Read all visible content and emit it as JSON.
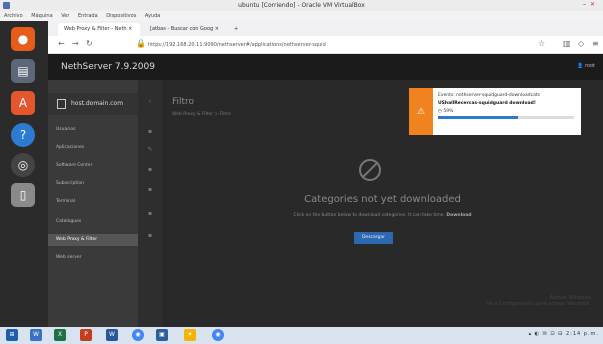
{
  "vm": {
    "title": "ubuntu [Corriendo] - Oracle VM VirtualBox",
    "menu": [
      "Archivo",
      "Máquina",
      "Ver",
      "Entrada",
      "Dispositivos",
      "Ayuda"
    ]
  },
  "browser": {
    "tabs": [
      {
        "label": "Web Proxy & Filter - Neth ×"
      },
      {
        "label": "[atbas - Buscar con Goog ×"
      },
      {
        "label": "+"
      }
    ],
    "url": "https://192.168.20.11:9090/nethserver#/applications/nethserver-squid"
  },
  "app": {
    "brand": "NethServer 7.9.2009",
    "user": "root",
    "hostname": "host.domain.com",
    "nav": [
      "Usuarios",
      "Aplicaciones",
      "Software Center",
      "Subscription",
      "Terminal",
      "Catalogues",
      "Web Proxy & Filter",
      "Web server"
    ],
    "active_nav": "Web Proxy & Filter"
  },
  "main": {
    "title": "Filtro",
    "breadcrumb": "Web Proxy & Filter > Filtro",
    "empty_title": "Categories not yet downloaded",
    "empty_desc": "Click on the button below to download categories. It can take time.",
    "empty_desc_bold": "Download",
    "button": "Descargar",
    "watermark_1": "Activar Windows",
    "watermark_2": "Ve a Configuración para activar Windows."
  },
  "toast": {
    "title": "Events: nethserver-squidguard-downloadcats",
    "message": "UShallRecercas-squidguard download!",
    "percent": "59%",
    "progress": 0.59
  },
  "taskbar": {
    "clock": "2:14 p.m."
  },
  "colors": {
    "accent": "#2c69b0",
    "warning": "#f0831f"
  }
}
